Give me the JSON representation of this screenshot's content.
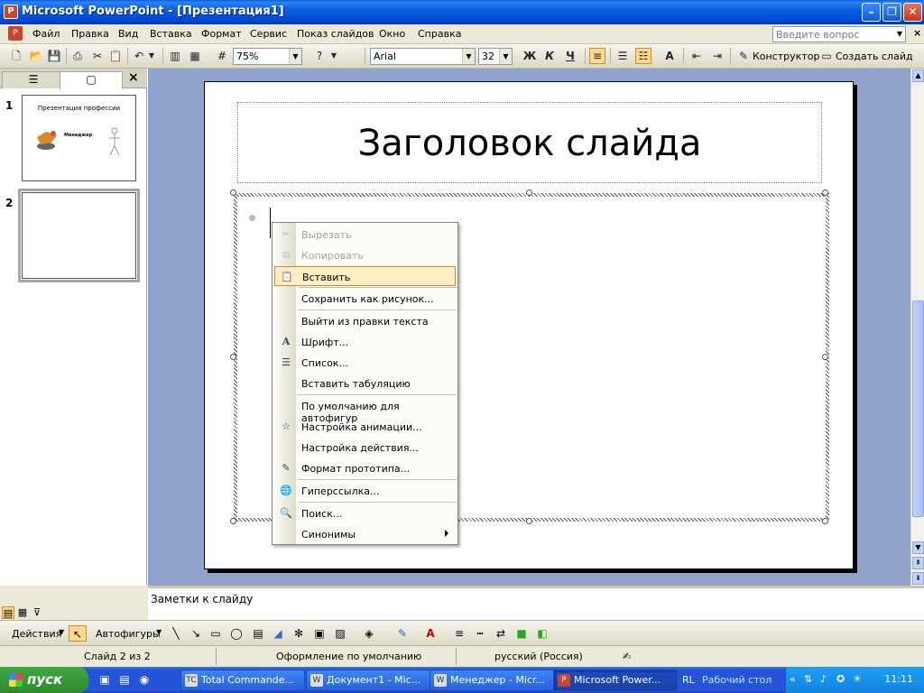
{
  "window": {
    "title": "Microsoft PowerPoint - [Презентация1]",
    "app_icon": "powerpoint-icon"
  },
  "menu": {
    "items": [
      "Файл",
      "Правка",
      "Вид",
      "Вставка",
      "Формат",
      "Сервис",
      "Показ слайдов",
      "Окно",
      "Справка"
    ],
    "ask_placeholder": "Введите вопрос"
  },
  "toolbar": {
    "zoom": "75%",
    "font": "Arial",
    "size": "32",
    "bold": "Ж",
    "italic": "К",
    "underline": "Ч",
    "designer_label": "Конструктор",
    "new_slide_label": "Создать слайд"
  },
  "slides": [
    {
      "number": "1",
      "title": "Презентация профессии",
      "subtitle": "Менеджер"
    },
    {
      "number": "2"
    }
  ],
  "slide": {
    "title": "Заголовок слайда"
  },
  "context_menu": {
    "items": [
      {
        "label": "Вырезать",
        "icon": "scissors-icon",
        "disabled": true
      },
      {
        "label": "Копировать",
        "icon": "copy-icon",
        "disabled": true
      },
      {
        "label": "Вставить",
        "icon": "paste-icon",
        "highlighted": true
      },
      {
        "label": "Сохранить как рисунок..."
      },
      {
        "label": "Выйти из правки текста"
      },
      {
        "label": "Шрифт...",
        "icon": "font-icon"
      },
      {
        "label": "Список...",
        "icon": "list-icon"
      },
      {
        "label": "Вставить табуляцию"
      },
      {
        "label": "По умолчанию для автофигур"
      },
      {
        "label": "Настройка анимации...",
        "icon": "animation-icon"
      },
      {
        "label": "Настройка действия..."
      },
      {
        "label": "Формат прототипа...",
        "icon": "format-icon"
      },
      {
        "label": "Гиперссылка...",
        "icon": "hyperlink-icon"
      },
      {
        "label": "Поиск...",
        "icon": "search-icon"
      },
      {
        "label": "Синонимы",
        "submenu": true
      }
    ]
  },
  "notes": {
    "placeholder": "Заметки к слайду"
  },
  "draw_toolbar": {
    "actions_label": "Действия",
    "autoshapes_label": "Автофигуры"
  },
  "status": {
    "slide": "Слайд 2 из 2",
    "design": "Оформление по умолчанию",
    "language": "русский (Россия)"
  },
  "taskbar": {
    "start_label": "пуск",
    "tasks": [
      "Total Commande...",
      "Документ1 - Mic...",
      "Менеджер - Micr...",
      "Microsoft Power..."
    ],
    "lang": "RL",
    "desktop_label": "Рабочий стол",
    "clock": "11:11"
  }
}
